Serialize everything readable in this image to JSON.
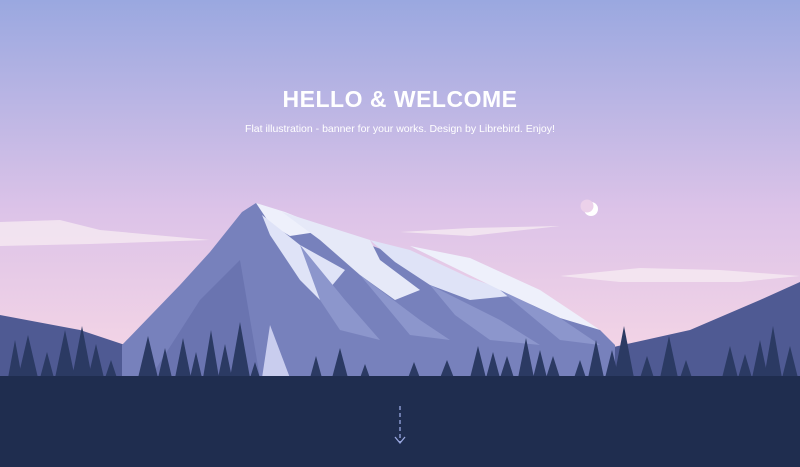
{
  "hero": {
    "title": "HELLO & WELCOME",
    "subtitle": "Flat illustration - banner for your works. Design by Librebird. Enjoy!"
  },
  "scroll_indicator": {
    "icon": "arrow-down-icon"
  },
  "colors": {
    "sky_top": "#9aa8e0",
    "sky_bottom": "#f3d4e6",
    "ground": "#1f2d4f",
    "mountain_shadow": "#6c78b4",
    "snow": "#eef0fb",
    "hills": "#4f5a93",
    "trees": "#2b3a63",
    "text": "#ffffff",
    "arrow": "#9aa8e0"
  }
}
